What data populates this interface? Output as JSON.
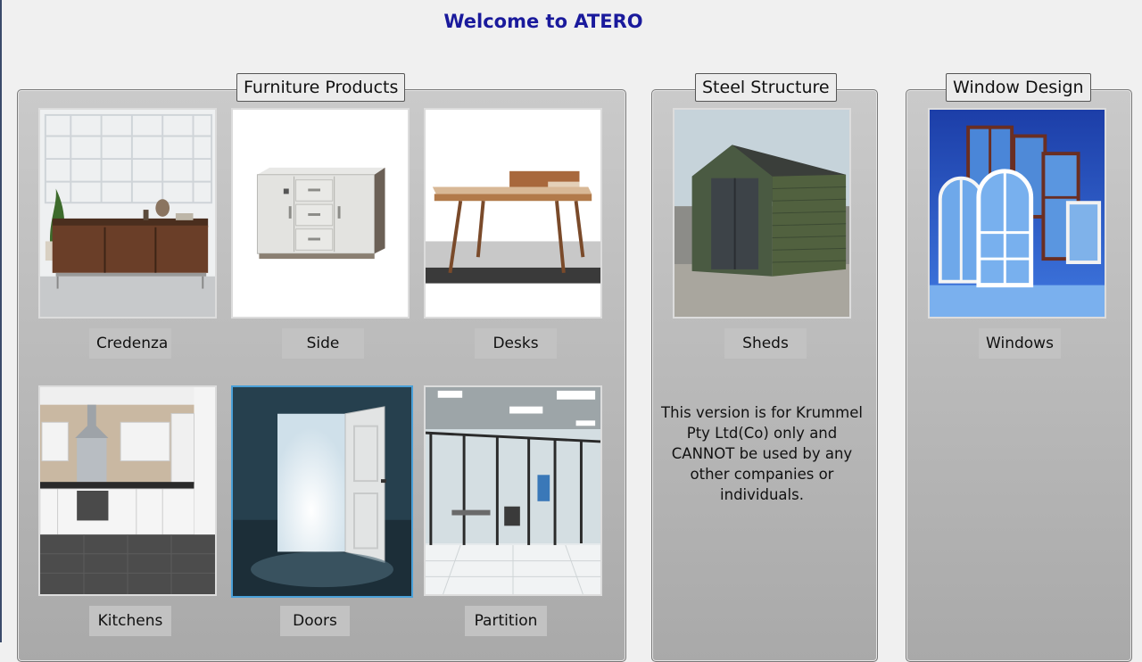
{
  "header": {
    "title": "Welcome to ATERO"
  },
  "sections": {
    "furniture": {
      "legend": "Furniture Products",
      "items": [
        {
          "label": "Credenza",
          "image": "credenza-image"
        },
        {
          "label": "Side",
          "image": "side-cabinet-image"
        },
        {
          "label": "Desks",
          "image": "desk-image"
        },
        {
          "label": "Kitchens",
          "image": "kitchen-image"
        },
        {
          "label": "Doors",
          "image": "door-image",
          "selected": true
        },
        {
          "label": "Partition",
          "image": "partition-image"
        }
      ]
    },
    "steel": {
      "legend": "Steel Structure",
      "items": [
        {
          "label": "Sheds",
          "image": "shed-image"
        }
      ],
      "notice": "This version is for Krummel Pty Ltd(Co) only and CANNOT be used by any other companies or individuals."
    },
    "window": {
      "legend": "Window Design",
      "items": [
        {
          "label": "Windows",
          "image": "windows-image"
        }
      ]
    }
  },
  "colors": {
    "title": "#1a1a9c",
    "panel_top": "#cacaca",
    "panel_bottom": "#a9a9a9",
    "caption_bg": "#c2c2c2",
    "selected_border": "#4aa0d8"
  }
}
